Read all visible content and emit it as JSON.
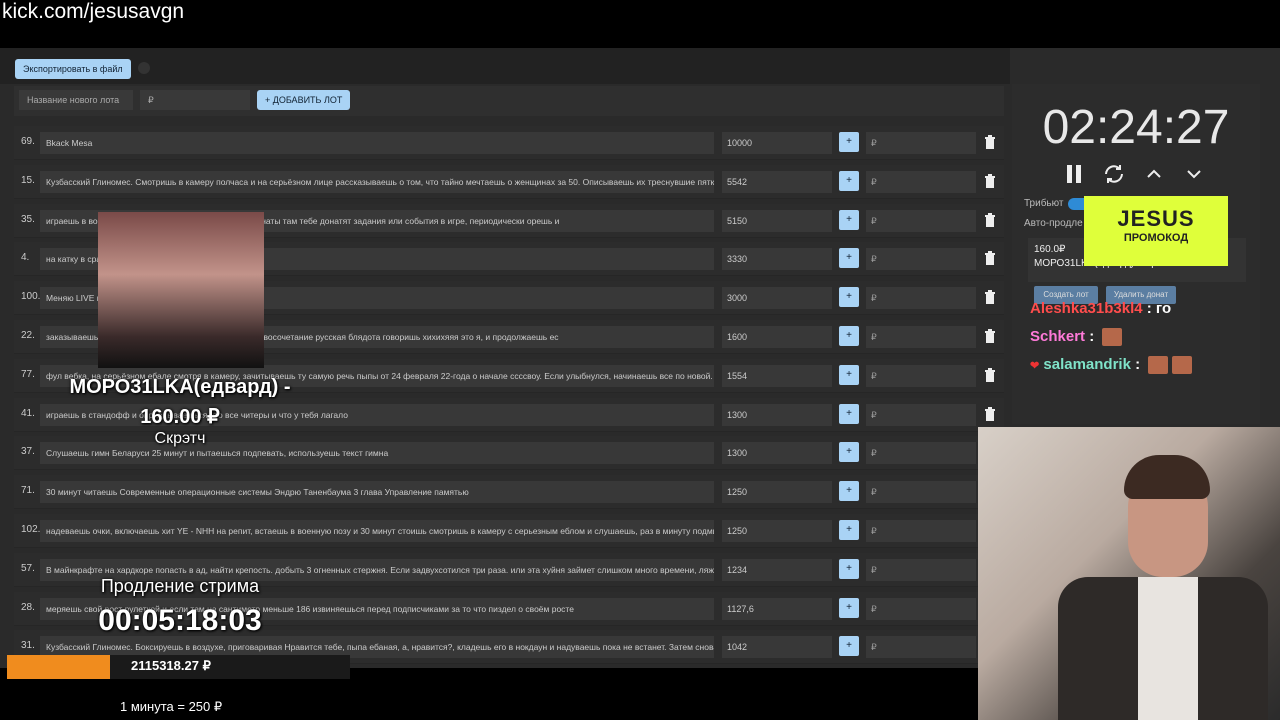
{
  "browser": {
    "url": "kick.com/jesusavgn"
  },
  "toolbar": {
    "export_label": "Экспортировать в файл"
  },
  "add_lot": {
    "name_placeholder": "Название нового лота",
    "price_placeholder": "₽",
    "add_label": "+ ДОБАВИТЬ ЛОТ"
  },
  "lot_plus_label": "+",
  "lot_rub_placeholder": "₽",
  "lots": [
    {
      "num": "69.",
      "name": "Bkack Mesa",
      "price": "10000"
    },
    {
      "num": "15.",
      "name": "Кузбасский Глиномес. Смотришь в камеру полчаса и на серьёзном лице рассказываешь о том, что тайно мечтаешь о женщинах за 50. Описываешь их треснувшие пятки и",
      "price": "5542"
    },
    {
      "num": "35.",
      "name": "играешь в вос",
      "name_tail": "тт будто он твой компаньон читаешь донаты там тебе донатят задания или события в игре, периодически орешь и",
      "price": "5150"
    },
    {
      "num": "4.",
      "name": "на катку в сраж",
      "name_tail": "й же выгорит",
      "price": "3330"
    },
    {
      "num": "100.",
      "name": "Меняю LIVE",
      "name_tail": "во от принтера canon*",
      "price": "3000"
    },
    {
      "num": "22.",
      "name": "заказываешь",
      "name_tail": "идет видео шлака, и если он говорит словосочетание русская блядота говоришь хихихяяя это я, и продолжаешь ес",
      "price": "1600"
    },
    {
      "num": "77.",
      "name": "фул вебка, на серьёзном ебале смотря в камеру, зачитываешь ту самую речь пыпы от 24 февраля 22-года о начале ссссвоу. Если улыбнулся, начинаешь все по новой.",
      "price": "1554"
    },
    {
      "num": "41.",
      "name": "играешь в стандофф и",
      "name_tail": "оправдываешься что все читеры и что у тебя лагало",
      "price": "1300"
    },
    {
      "num": "37.",
      "name": "Слушаешь гимн Беларуси 25 минут и пытаешься подпевать, используешь текст гимна",
      "price": "1300"
    },
    {
      "num": "71.",
      "name": "30 минут читаешь Современные операционные системы Эндрю Таненбаума 3 глава Управление памятью",
      "price": "1250"
    },
    {
      "num": "102.",
      "name": "надеваешь очки, включаешь хит YE - NHH на репит, встаешь в военную позу и 30 минут стоишь смотришь в камеру с серьезным еблом и слушаешь, раз в минуту подми",
      "price": "1250"
    },
    {
      "num": "57.",
      "name": "В майнкрафте на хардкоре попасть в ад, найти крепость. добыть 3 огненных стержня. Если задвухсотился три раза. или эта хуйня займет слишком много времени, ляжь н",
      "price": "1234"
    },
    {
      "num": "28.",
      "name": "меряешь свой рост рулеткой и если там на сантиметр меньше 186 извиняешься перед подписчиками за то что пиздел о своём росте",
      "price": "1127,6"
    },
    {
      "num": "31.",
      "name": "Кузбасский Глиномес. Боксируешь в воздухе, приговаривая Нравится тебе, пыпа ебаная, а, нравится?, кладешь его в нокдаун и надуваешь пока не встанет. Затем снова х",
      "price": "1042"
    }
  ],
  "right_panel": {
    "timer": "02:24:27",
    "tributes_label": "Трибьют",
    "autoextend_label": "Авто-продле",
    "promo_title": "JESUS",
    "promo_sub": "ПРОМОКОД",
    "donation_amount": "160.0₽",
    "donation_text": "МОРО31LKA(едвард): Скрэтч",
    "btn_create": "Создать лот",
    "btn_delete": "Удалить донат"
  },
  "chat": [
    {
      "user": "Aleshka31b3kl4",
      "sep": " : ",
      "msg": "го",
      "color": "#ff4d4d"
    },
    {
      "user": "Schkert",
      "sep": " : ",
      "msg": "",
      "color": "#ff7ad9"
    },
    {
      "user": "salamandrik",
      "sep": " : ",
      "msg": "",
      "color": "#7fe3c9"
    }
  ],
  "alert": {
    "donor": "МОРО31LKA(едвард) -",
    "amount": "160.00 ₽",
    "message": "Скрэтч"
  },
  "extension": {
    "title": "Продление стрима",
    "countdown": "00:05:18:03",
    "total": "2115318.27 ₽",
    "progress": 0.3,
    "rate": "1 минута = 250 ₽"
  },
  "colors": {
    "accent": "#a9d3f5",
    "progress": "#f08c1e",
    "promo": "#dfff3a"
  },
  "icons": [
    "trash-icon",
    "pause-icon",
    "refresh-icon",
    "chevron-up-icon",
    "chevron-down-icon"
  ]
}
